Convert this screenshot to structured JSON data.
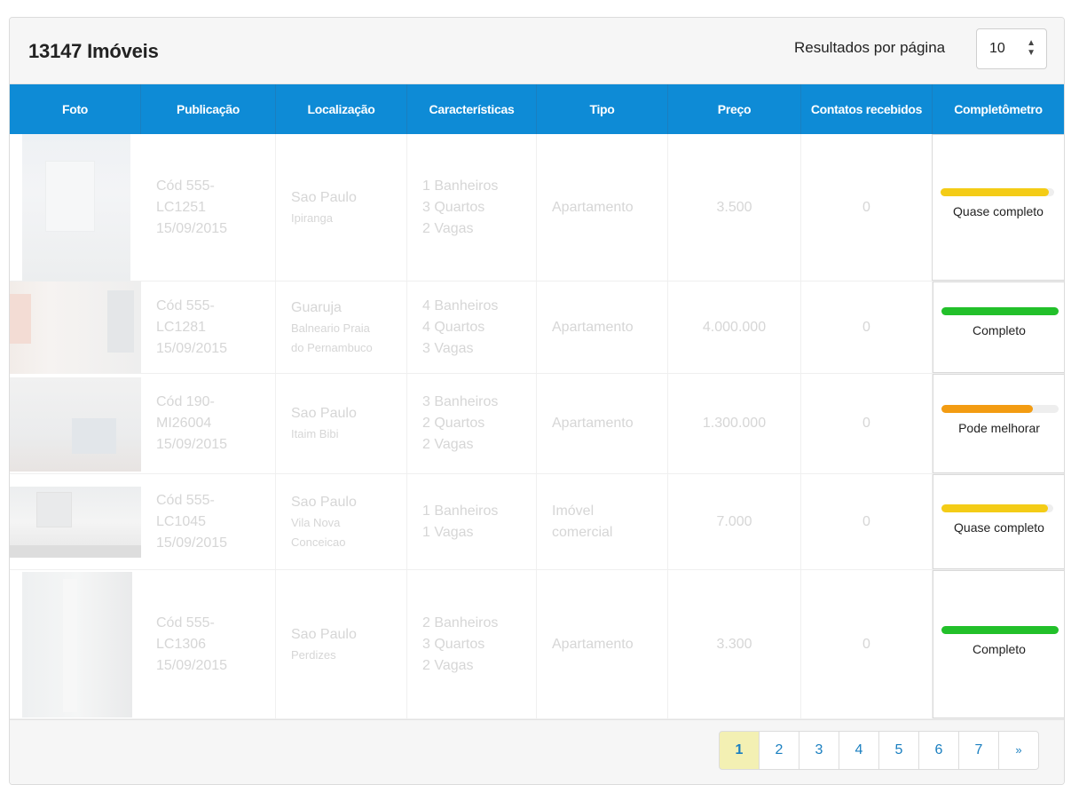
{
  "header": {
    "count_title": "13147 Imóveis",
    "per_page_label": "Resultados por página",
    "per_page_value": "10"
  },
  "table": {
    "columns": [
      "Foto",
      "Publicação",
      "Localização",
      "Características",
      "Tipo",
      "Preço",
      "Contatos recebidos",
      "Completômetro"
    ],
    "rows": [
      {
        "pub": [
          "Cód 555-",
          "LC1251",
          "15/09/2015"
        ],
        "city": "Sao Paulo",
        "district": [
          "Ipiranga"
        ],
        "features": [
          "1 Banheiros",
          "3 Quartos",
          "2 Vagas"
        ],
        "type": [
          "Apartamento"
        ],
        "price": "3.500",
        "contacts": "0",
        "meter_label": "Quase completo",
        "meter_level": 0.95,
        "meter_color": "#f4cc16"
      },
      {
        "pub": [
          "Cód 555-",
          "LC1281",
          "15/09/2015"
        ],
        "city": "Guaruja",
        "district": [
          "Balneario Praia",
          "do Pernambuco"
        ],
        "features": [
          "4 Banheiros",
          "4 Quartos",
          "3 Vagas"
        ],
        "type": [
          "Apartamento"
        ],
        "price": "4.000.000",
        "contacts": "0",
        "meter_label": "Completo",
        "meter_level": 1.0,
        "meter_color": "#22c02a"
      },
      {
        "pub": [
          "Cód 190-",
          "MI26004",
          "15/09/2015"
        ],
        "city": "Sao Paulo",
        "district": [
          "Itaim Bibi"
        ],
        "features": [
          "3 Banheiros",
          "2 Quartos",
          "2 Vagas"
        ],
        "type": [
          "Apartamento"
        ],
        "price": "1.300.000",
        "contacts": "0",
        "meter_label": "Pode melhorar",
        "meter_level": 0.78,
        "meter_color": "#f39c12"
      },
      {
        "pub": [
          "Cód 555-",
          "LC1045",
          "15/09/2015"
        ],
        "city": "Sao Paulo",
        "district": [
          "Vila Nova",
          "Conceicao"
        ],
        "features": [
          "1 Banheiros",
          "1 Vagas"
        ],
        "type": [
          "Imóvel",
          "comercial"
        ],
        "price": "7.000",
        "contacts": "0",
        "meter_label": "Quase completo",
        "meter_level": 0.95,
        "meter_color": "#f4cc16"
      },
      {
        "pub": [
          "Cód 555-",
          "LC1306",
          "15/09/2015"
        ],
        "city": "Sao Paulo",
        "district": [
          "Perdizes"
        ],
        "features": [
          "2 Banheiros",
          "3 Quartos",
          "2 Vagas"
        ],
        "type": [
          "Apartamento"
        ],
        "price": "3.300",
        "contacts": "0",
        "meter_label": "Completo",
        "meter_level": 1.0,
        "meter_color": "#22c02a"
      }
    ]
  },
  "pagination": {
    "pages": [
      "1",
      "2",
      "3",
      "4",
      "5",
      "6",
      "7"
    ],
    "active": "1",
    "next": "»"
  },
  "colors": {
    "header_blue": "#0e8bd6",
    "faded_text": "#d6d6d6",
    "active_page": "#f3f0b3"
  }
}
